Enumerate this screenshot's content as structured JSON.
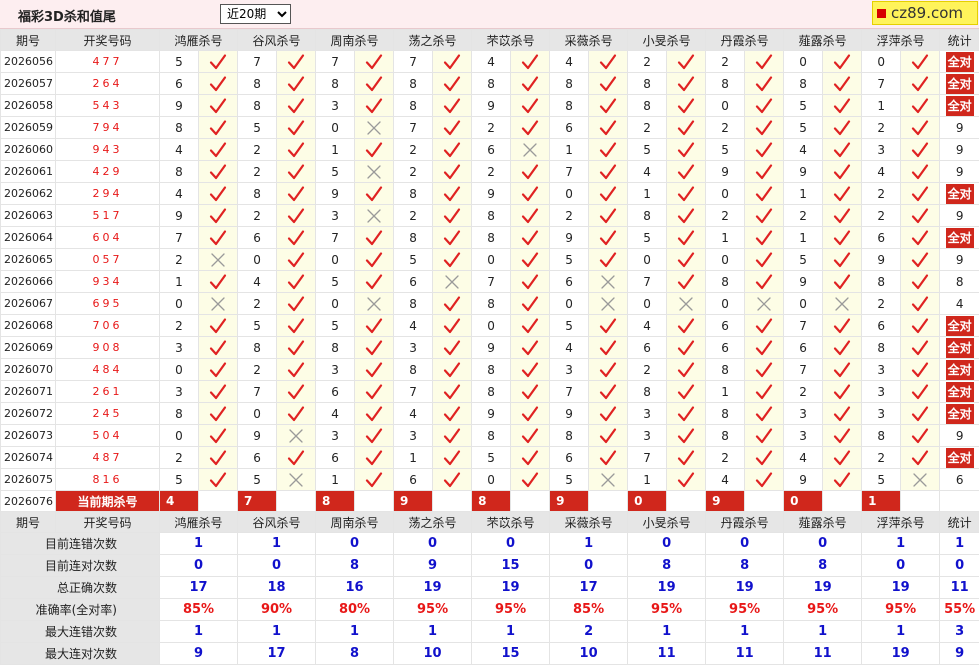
{
  "header": {
    "title": "福彩3D杀和值尾",
    "range_select": {
      "selected": "近20期",
      "options": [
        "近20期"
      ]
    },
    "logo_text": "cz89.com"
  },
  "table": {
    "head": {
      "period": "期号",
      "numbers": "开奖号码",
      "stats": "统计"
    },
    "experts": [
      "鸿雁杀号",
      "谷风杀号",
      "周南杀号",
      "荡之杀号",
      "芣苡杀号",
      "采薇杀号",
      "小旻杀号",
      "丹霞杀号",
      "薤露杀号",
      "浮萍杀号"
    ],
    "rows": [
      {
        "period": "2026056",
        "nums": "477",
        "kills": [
          5,
          7,
          7,
          7,
          4,
          4,
          2,
          2,
          0,
          0
        ],
        "hits": [
          1,
          1,
          1,
          1,
          1,
          1,
          1,
          1,
          1,
          1
        ],
        "stat": "全对"
      },
      {
        "period": "2026057",
        "nums": "264",
        "kills": [
          6,
          8,
          8,
          8,
          8,
          8,
          8,
          8,
          8,
          7
        ],
        "hits": [
          1,
          1,
          1,
          1,
          1,
          1,
          1,
          1,
          1,
          1
        ],
        "stat": "全对"
      },
      {
        "period": "2026058",
        "nums": "543",
        "kills": [
          9,
          8,
          3,
          8,
          9,
          8,
          8,
          0,
          5,
          1
        ],
        "hits": [
          1,
          1,
          1,
          1,
          1,
          1,
          1,
          1,
          1,
          1
        ],
        "stat": "全对"
      },
      {
        "period": "2026059",
        "nums": "794",
        "kills": [
          8,
          5,
          0,
          7,
          2,
          6,
          2,
          2,
          5,
          2
        ],
        "hits": [
          1,
          1,
          0,
          1,
          1,
          1,
          1,
          1,
          1,
          1
        ],
        "stat": "9"
      },
      {
        "period": "2026060",
        "nums": "943",
        "kills": [
          4,
          2,
          1,
          2,
          6,
          1,
          5,
          5,
          4,
          3
        ],
        "hits": [
          1,
          1,
          1,
          1,
          0,
          1,
          1,
          1,
          1,
          1
        ],
        "stat": "9"
      },
      {
        "period": "2026061",
        "nums": "429",
        "kills": [
          8,
          2,
          5,
          2,
          2,
          7,
          4,
          9,
          9,
          4
        ],
        "hits": [
          1,
          1,
          0,
          1,
          1,
          1,
          1,
          1,
          1,
          1
        ],
        "stat": "9"
      },
      {
        "period": "2026062",
        "nums": "294",
        "kills": [
          4,
          8,
          9,
          8,
          9,
          0,
          1,
          0,
          1,
          2
        ],
        "hits": [
          1,
          1,
          1,
          1,
          1,
          1,
          1,
          1,
          1,
          1
        ],
        "stat": "全对"
      },
      {
        "period": "2026063",
        "nums": "517",
        "kills": [
          9,
          2,
          3,
          2,
          8,
          2,
          8,
          2,
          2,
          2
        ],
        "hits": [
          1,
          1,
          0,
          1,
          1,
          1,
          1,
          1,
          1,
          1
        ],
        "stat": "9"
      },
      {
        "period": "2026064",
        "nums": "604",
        "kills": [
          7,
          6,
          7,
          8,
          8,
          9,
          5,
          1,
          1,
          6
        ],
        "hits": [
          1,
          1,
          1,
          1,
          1,
          1,
          1,
          1,
          1,
          1
        ],
        "stat": "全对"
      },
      {
        "period": "2026065",
        "nums": "057",
        "kills": [
          2,
          0,
          0,
          5,
          0,
          5,
          0,
          0,
          5,
          9
        ],
        "hits": [
          0,
          1,
          1,
          1,
          1,
          1,
          1,
          1,
          1,
          1
        ],
        "stat": "9"
      },
      {
        "period": "2026066",
        "nums": "934",
        "kills": [
          1,
          4,
          5,
          6,
          7,
          6,
          7,
          8,
          9,
          8
        ],
        "hits": [
          1,
          1,
          1,
          0,
          1,
          0,
          1,
          1,
          1,
          1
        ],
        "stat": "8"
      },
      {
        "period": "2026067",
        "nums": "695",
        "kills": [
          0,
          2,
          0,
          8,
          8,
          0,
          0,
          0,
          0,
          2
        ],
        "hits": [
          0,
          1,
          0,
          1,
          1,
          0,
          0,
          0,
          0,
          1
        ],
        "stat": "4"
      },
      {
        "period": "2026068",
        "nums": "706",
        "kills": [
          2,
          5,
          5,
          4,
          0,
          5,
          4,
          6,
          7,
          6
        ],
        "hits": [
          1,
          1,
          1,
          1,
          1,
          1,
          1,
          1,
          1,
          1
        ],
        "stat": "全对"
      },
      {
        "period": "2026069",
        "nums": "908",
        "kills": [
          3,
          8,
          8,
          3,
          9,
          4,
          6,
          6,
          6,
          8
        ],
        "hits": [
          1,
          1,
          1,
          1,
          1,
          1,
          1,
          1,
          1,
          1
        ],
        "stat": "全对"
      },
      {
        "period": "2026070",
        "nums": "484",
        "kills": [
          0,
          2,
          3,
          8,
          8,
          3,
          2,
          8,
          7,
          3
        ],
        "hits": [
          1,
          1,
          1,
          1,
          1,
          1,
          1,
          1,
          1,
          1
        ],
        "stat": "全对"
      },
      {
        "period": "2026071",
        "nums": "261",
        "kills": [
          3,
          7,
          6,
          7,
          8,
          7,
          8,
          1,
          2,
          3
        ],
        "hits": [
          1,
          1,
          1,
          1,
          1,
          1,
          1,
          1,
          1,
          1
        ],
        "stat": "全对"
      },
      {
        "period": "2026072",
        "nums": "245",
        "kills": [
          8,
          0,
          4,
          4,
          9,
          9,
          3,
          8,
          3,
          3
        ],
        "hits": [
          1,
          1,
          1,
          1,
          1,
          1,
          1,
          1,
          1,
          1
        ],
        "stat": "全对"
      },
      {
        "period": "2026073",
        "nums": "504",
        "kills": [
          0,
          9,
          3,
          3,
          8,
          8,
          3,
          8,
          3,
          8
        ],
        "hits": [
          1,
          0,
          1,
          1,
          1,
          1,
          1,
          1,
          1,
          1
        ],
        "stat": "9"
      },
      {
        "period": "2026074",
        "nums": "487",
        "kills": [
          2,
          6,
          6,
          1,
          5,
          6,
          7,
          2,
          4,
          2
        ],
        "hits": [
          1,
          1,
          1,
          1,
          1,
          1,
          1,
          1,
          1,
          1
        ],
        "stat": "全对"
      },
      {
        "period": "2026075",
        "nums": "816",
        "kills": [
          5,
          5,
          1,
          6,
          0,
          5,
          1,
          4,
          9,
          5
        ],
        "hits": [
          1,
          0,
          1,
          1,
          1,
          0,
          1,
          1,
          1,
          0
        ],
        "stat": "6"
      }
    ],
    "current": {
      "period": "2026076",
      "label": "当前期杀号",
      "kills": [
        4,
        7,
        8,
        9,
        8,
        9,
        0,
        9,
        0,
        1
      ]
    },
    "stats": {
      "labels": [
        "目前连错次数",
        "目前连对次数",
        "总正确次数",
        "准确率(全对率)",
        "最大连错次数",
        "最大连对次数"
      ],
      "values": [
        [
          "1",
          "1",
          "0",
          "0",
          "0",
          "1",
          "0",
          "0",
          "0",
          "1",
          "1"
        ],
        [
          "0",
          "0",
          "8",
          "9",
          "15",
          "0",
          "8",
          "8",
          "8",
          "0",
          "0"
        ],
        [
          "17",
          "18",
          "16",
          "19",
          "19",
          "17",
          "19",
          "19",
          "19",
          "19",
          "11"
        ],
        [
          "85%",
          "90%",
          "80%",
          "95%",
          "95%",
          "85%",
          "95%",
          "95%",
          "95%",
          "95%",
          "55%"
        ],
        [
          "1",
          "1",
          "1",
          "1",
          "1",
          "2",
          "1",
          "1",
          "1",
          "1",
          "3"
        ],
        [
          "9",
          "17",
          "8",
          "10",
          "15",
          "10",
          "11",
          "11",
          "11",
          "19",
          "9"
        ]
      ]
    }
  },
  "colors": {
    "accent_red": "#d0271c",
    "check_red": "#e02222",
    "cross_gray": "#9a9a9a",
    "stat_blue": "#1111cc"
  }
}
